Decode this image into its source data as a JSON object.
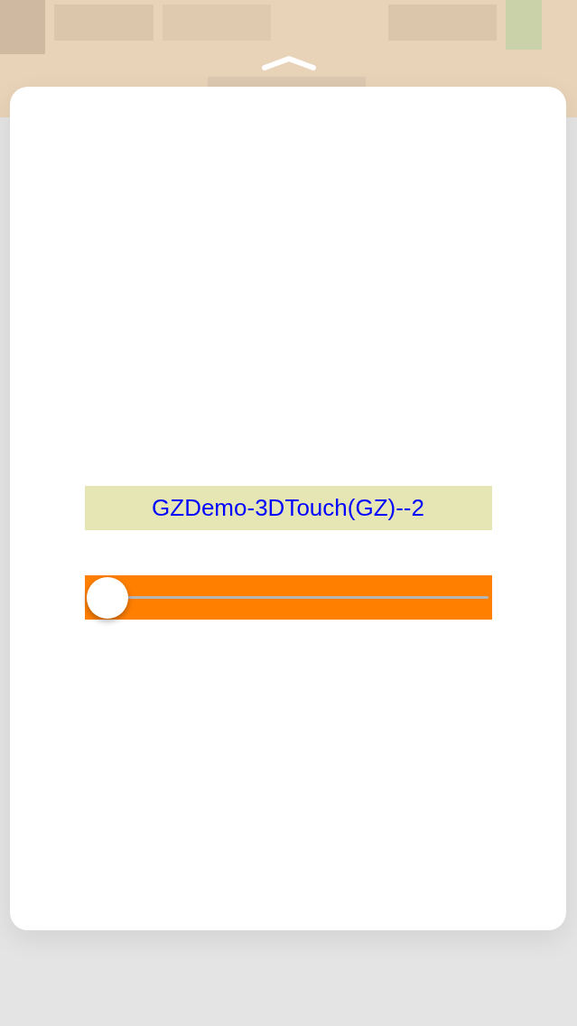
{
  "preview": {
    "title": "GZDemo-3DTouch(GZ)--2",
    "slider": {
      "level": 0
    }
  }
}
